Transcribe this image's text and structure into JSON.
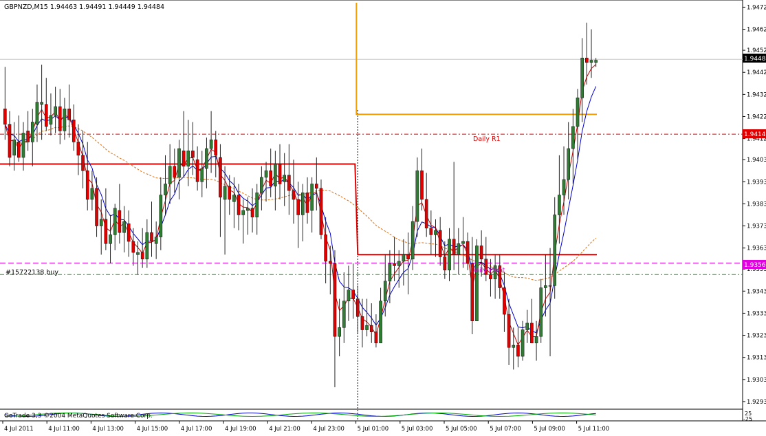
{
  "chart_header": {
    "text": "GBPNZD,M15  1.94463 1.94491 1.94449 1.94484"
  },
  "colors": {
    "bull": "#2e7d32",
    "bear": "#e00000",
    "wick": "#222222",
    "ma_fast": "#d00000",
    "ma_mid": "#0000cc",
    "ma_slow": "#e07010",
    "pivot": "#e00000",
    "period_box": "#f5a000",
    "buy_line": "#2e8b2e",
    "magenta": "#e000e0",
    "bid_line": "#c8c8c8"
  },
  "chart_data": {
    "type": "candlestick",
    "symbol": "GBPNZD",
    "timeframe": "M15",
    "ylim": [
      1.9291,
      1.9474
    ],
    "price_ticks": [
      "1.94720",
      "1.94620",
      "1.94525",
      "1.94425",
      "1.94325",
      "1.94225",
      "1.94125",
      "1.94030",
      "1.93930",
      "1.93830",
      "1.93730",
      "1.93630",
      "1.93535",
      "1.93435",
      "1.93335",
      "1.93235",
      "1.93135",
      "1.93035",
      "1.92935"
    ],
    "time_ticks": [
      "4 Jul 2011",
      "4 Jul 11:00",
      "4 Jul 13:00",
      "4 Jul 15:00",
      "4 Jul 17:00",
      "4 Jul 19:00",
      "4 Jul 21:00",
      "4 Jul 23:00",
      "5 Jul 01:00",
      "5 Jul 03:00",
      "5 Jul 05:00",
      "5 Jul 07:00",
      "5 Jul 09:00",
      "5 Jul 11:00"
    ],
    "candles": [
      [
        1.9426,
        1.9445,
        1.9412,
        1.9419
      ],
      [
        1.9419,
        1.9425,
        1.94,
        1.9404
      ],
      [
        1.9405,
        1.942,
        1.9398,
        1.9412
      ],
      [
        1.9411,
        1.9423,
        1.9402,
        1.9404
      ],
      [
        1.9404,
        1.942,
        1.9398,
        1.9415
      ],
      [
        1.9416,
        1.9425,
        1.9407,
        1.9411
      ],
      [
        1.9411,
        1.9426,
        1.94,
        1.942
      ],
      [
        1.9419,
        1.9437,
        1.9411,
        1.9429
      ],
      [
        1.9428,
        1.9446,
        1.9412,
        1.9429
      ],
      [
        1.9428,
        1.944,
        1.9416,
        1.9418
      ],
      [
        1.9419,
        1.9433,
        1.9414,
        1.9423
      ],
      [
        1.9423,
        1.9436,
        1.9415,
        1.9427
      ],
      [
        1.9427,
        1.9435,
        1.941,
        1.9416
      ],
      [
        1.9416,
        1.9431,
        1.9412,
        1.9426
      ],
      [
        1.9426,
        1.9437,
        1.9413,
        1.9421
      ],
      [
        1.9421,
        1.9428,
        1.9407,
        1.9411
      ],
      [
        1.9411,
        1.9419,
        1.9396,
        1.9405
      ],
      [
        1.9405,
        1.9416,
        1.939,
        1.9398
      ],
      [
        1.9398,
        1.9411,
        1.938,
        1.9385
      ],
      [
        1.9385,
        1.9398,
        1.938,
        1.939
      ],
      [
        1.939,
        1.9395,
        1.9368,
        1.9373
      ],
      [
        1.9373,
        1.9385,
        1.936,
        1.9376
      ],
      [
        1.9376,
        1.939,
        1.9362,
        1.9365
      ],
      [
        1.9365,
        1.9378,
        1.9356,
        1.9369
      ],
      [
        1.9369,
        1.9383,
        1.9362,
        1.9381
      ],
      [
        1.938,
        1.9392,
        1.9365,
        1.937
      ],
      [
        1.937,
        1.9382,
        1.9361,
        1.9375
      ],
      [
        1.9374,
        1.938,
        1.9359,
        1.9366
      ],
      [
        1.9366,
        1.9372,
        1.9355,
        1.9361
      ],
      [
        1.936,
        1.9366,
        1.9351,
        1.9361
      ],
      [
        1.9361,
        1.9372,
        1.9354,
        1.9358
      ],
      [
        1.9358,
        1.9376,
        1.9354,
        1.937
      ],
      [
        1.937,
        1.9384,
        1.9359,
        1.9366
      ],
      [
        1.9365,
        1.9375,
        1.9358,
        1.9368
      ],
      [
        1.9368,
        1.9395,
        1.9362,
        1.9387
      ],
      [
        1.9387,
        1.9405,
        1.9378,
        1.9392
      ],
      [
        1.9392,
        1.941,
        1.9383,
        1.94
      ],
      [
        1.94,
        1.9408,
        1.9388,
        1.9395
      ],
      [
        1.9395,
        1.9412,
        1.9385,
        1.9408
      ],
      [
        1.9407,
        1.9425,
        1.9395,
        1.94
      ],
      [
        1.94,
        1.9421,
        1.9391,
        1.9407
      ],
      [
        1.9407,
        1.942,
        1.9396,
        1.9404
      ],
      [
        1.9403,
        1.9409,
        1.9389,
        1.9393
      ],
      [
        1.9393,
        1.9407,
        1.9386,
        1.9399
      ],
      [
        1.9399,
        1.9413,
        1.939,
        1.9408
      ],
      [
        1.9408,
        1.9425,
        1.9397,
        1.9412
      ],
      [
        1.9412,
        1.9416,
        1.9395,
        1.9405
      ],
      [
        1.9404,
        1.941,
        1.9368,
        1.9386
      ],
      [
        1.9385,
        1.94,
        1.936,
        1.9391
      ],
      [
        1.9391,
        1.9396,
        1.9378,
        1.9385
      ],
      [
        1.9384,
        1.9395,
        1.9372,
        1.9387
      ],
      [
        1.9387,
        1.9392,
        1.9371,
        1.9378
      ],
      [
        1.9378,
        1.9385,
        1.9365,
        1.938
      ],
      [
        1.938,
        1.9386,
        1.9369,
        1.9381
      ],
      [
        1.9381,
        1.939,
        1.937,
        1.9377
      ],
      [
        1.9377,
        1.9392,
        1.9369,
        1.9388
      ],
      [
        1.9388,
        1.94,
        1.938,
        1.9395
      ],
      [
        1.9395,
        1.9402,
        1.9384,
        1.9398
      ],
      [
        1.9398,
        1.9408,
        1.9386,
        1.9391
      ],
      [
        1.9391,
        1.9407,
        1.938,
        1.9401
      ],
      [
        1.9401,
        1.941,
        1.9385,
        1.9392
      ],
      [
        1.9393,
        1.9406,
        1.9382,
        1.9396
      ],
      [
        1.9396,
        1.941,
        1.9378,
        1.9389
      ],
      [
        1.9389,
        1.9403,
        1.9374,
        1.9385
      ],
      [
        1.9385,
        1.9393,
        1.9363,
        1.9378
      ],
      [
        1.9378,
        1.9392,
        1.9366,
        1.9388
      ],
      [
        1.9388,
        1.9395,
        1.9374,
        1.9379
      ],
      [
        1.938,
        1.9395,
        1.937,
        1.9392
      ],
      [
        1.9392,
        1.9404,
        1.938,
        1.939
      ],
      [
        1.939,
        1.9394,
        1.9367,
        1.9369
      ],
      [
        1.9369,
        1.9377,
        1.9347,
        1.9357
      ],
      [
        1.9357,
        1.9364,
        1.9342,
        1.9356
      ],
      [
        1.9356,
        1.9362,
        1.93,
        1.9323
      ],
      [
        1.9323,
        1.934,
        1.9314,
        1.9327
      ],
      [
        1.9327,
        1.9352,
        1.932,
        1.9339
      ],
      [
        1.9339,
        1.9355,
        1.933,
        1.9344
      ],
      [
        1.9344,
        1.9356,
        1.9331,
        1.934
      ],
      [
        1.934,
        1.9346,
        1.9324,
        1.9332
      ],
      [
        1.9332,
        1.934,
        1.9318,
        1.9326
      ],
      [
        1.9326,
        1.934,
        1.9323,
        1.9328
      ],
      [
        1.9328,
        1.9338,
        1.932,
        1.9325
      ],
      [
        1.9325,
        1.9333,
        1.9318,
        1.932
      ],
      [
        1.932,
        1.9345,
        1.9322,
        1.9339
      ],
      [
        1.9339,
        1.936,
        1.9332,
        1.9348
      ],
      [
        1.9348,
        1.9362,
        1.9338,
        1.9356
      ],
      [
        1.9356,
        1.9368,
        1.9348,
        1.9355
      ],
      [
        1.9355,
        1.9362,
        1.9345,
        1.9357
      ],
      [
        1.9357,
        1.9367,
        1.9346,
        1.936
      ],
      [
        1.936,
        1.937,
        1.9342,
        1.9358
      ],
      [
        1.9358,
        1.9382,
        1.9353,
        1.9375
      ],
      [
        1.9375,
        1.9404,
        1.9368,
        1.9398
      ],
      [
        1.9398,
        1.9408,
        1.938,
        1.9385
      ],
      [
        1.9385,
        1.9397,
        1.9368,
        1.9372
      ],
      [
        1.9372,
        1.938,
        1.936,
        1.9369
      ],
      [
        1.9369,
        1.9376,
        1.9359,
        1.9371
      ],
      [
        1.9371,
        1.9377,
        1.9355,
        1.9359
      ],
      [
        1.9359,
        1.9366,
        1.9349,
        1.9353
      ],
      [
        1.9353,
        1.9372,
        1.9348,
        1.9367
      ],
      [
        1.9367,
        1.9402,
        1.9353,
        1.936
      ],
      [
        1.936,
        1.9372,
        1.9351,
        1.9365
      ],
      [
        1.9365,
        1.9377,
        1.9354,
        1.9366
      ],
      [
        1.9366,
        1.937,
        1.9353,
        1.9356
      ],
      [
        1.9356,
        1.9368,
        1.9324,
        1.933
      ],
      [
        1.933,
        1.9367,
        1.9338,
        1.9364
      ],
      [
        1.9364,
        1.9371,
        1.935,
        1.9358
      ],
      [
        1.9358,
        1.9368,
        1.9348,
        1.9351
      ],
      [
        1.9351,
        1.9358,
        1.9341,
        1.9349
      ],
      [
        1.9349,
        1.936,
        1.934,
        1.9355
      ],
      [
        1.9355,
        1.936,
        1.934,
        1.9345
      ],
      [
        1.9345,
        1.9352,
        1.9325,
        1.9333
      ],
      [
        1.9333,
        1.934,
        1.931,
        1.9318
      ],
      [
        1.9318,
        1.9327,
        1.9308,
        1.9319
      ],
      [
        1.9319,
        1.9327,
        1.9309,
        1.9314
      ],
      [
        1.9314,
        1.933,
        1.9312,
        1.9326
      ],
      [
        1.9326,
        1.9335,
        1.932,
        1.9329
      ],
      [
        1.9329,
        1.934,
        1.9322,
        1.932
      ],
      [
        1.932,
        1.933,
        1.9312,
        1.9323
      ],
      [
        1.9323,
        1.9349,
        1.932,
        1.9345
      ],
      [
        1.9345,
        1.936,
        1.9332,
        1.9346
      ],
      [
        1.9346,
        1.9363,
        1.9314,
        1.9346
      ],
      [
        1.9346,
        1.9386,
        1.934,
        1.9378
      ],
      [
        1.9378,
        1.9405,
        1.9365,
        1.9387
      ],
      [
        1.9387,
        1.9409,
        1.9378,
        1.9394
      ],
      [
        1.9394,
        1.942,
        1.9385,
        1.9408
      ],
      [
        1.9408,
        1.9426,
        1.9392,
        1.9418
      ],
      [
        1.9418,
        1.9435,
        1.9403,
        1.9431
      ],
      [
        1.9431,
        1.9458,
        1.942,
        1.9449
      ],
      [
        1.9449,
        1.9465,
        1.9437,
        1.9447
      ],
      [
        1.9447,
        1.9462,
        1.944,
        1.9448
      ],
      [
        1.9447,
        1.9449,
        1.9445,
        1.9448
      ]
    ],
    "indicators": {
      "ma_fast": "red moving average",
      "ma_mid": "blue moving average",
      "ma_slow": "dashed orange moving average"
    },
    "levels": {
      "bid": 1.94484,
      "daily_r1": 1.94145,
      "buy_price": 1.93562,
      "buy_stop": 1.9351,
      "pivot_left": 1.9401,
      "pivot_right": 1.936,
      "period_box_top": 1.9474,
      "period_box_bottom": 1.94235
    },
    "labels": {
      "bid_label": "1.94484",
      "r1_label": "1.94145",
      "buy_label": "1.93562",
      "r1_text": "Daily R1",
      "buy_text": "#15722138 buy",
      "buy_text_right": "Daily Pivot",
      "indicator_caption": "GoTrade 3,3 ©2004 MetaQuotes Software Corp.",
      "sub_scale": [
        "25",
        "-25"
      ]
    }
  }
}
